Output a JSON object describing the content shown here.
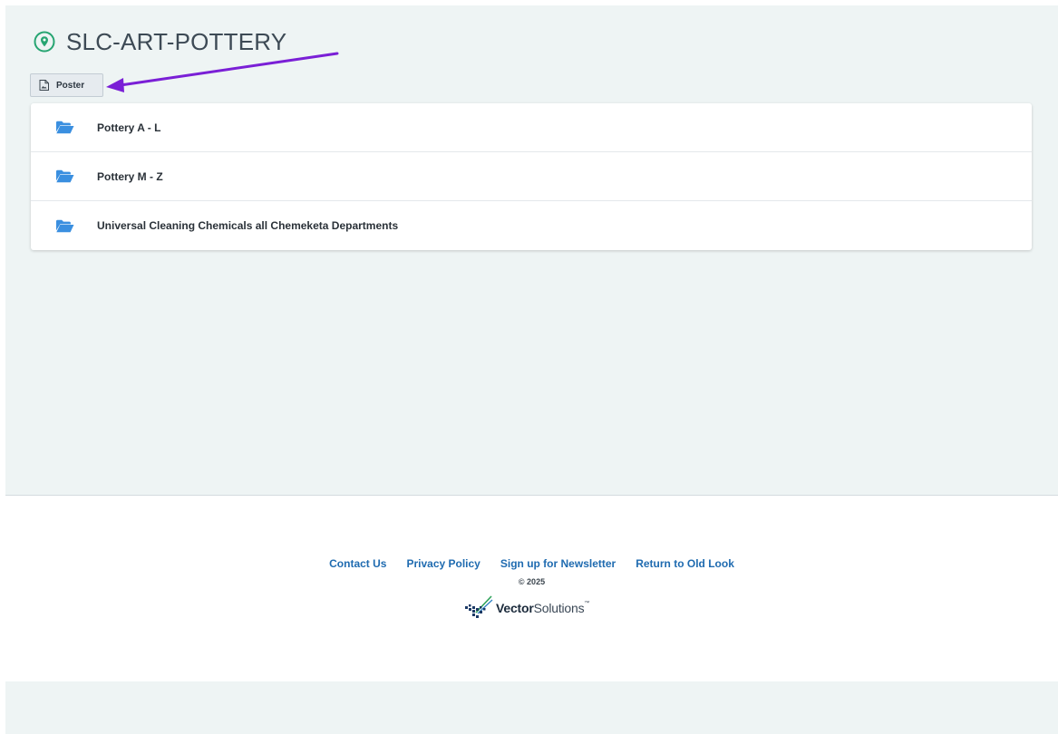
{
  "page": {
    "title": "SLC-ART-POTTERY",
    "location_icon": "map-pin-icon",
    "accent_color": "#27a572"
  },
  "toolbar": {
    "poster_label": "Poster",
    "poster_icon": "image-file-icon"
  },
  "annotation": {
    "arrow_color": "#7a1fd6",
    "points_to": "poster-button"
  },
  "folders": {
    "icon": "folder-open-icon",
    "icon_color": "#3a8fe0",
    "items": [
      {
        "label": "Pottery A - L"
      },
      {
        "label": "Pottery M - Z"
      },
      {
        "label": "Universal Cleaning Chemicals all Chemeketa Departments"
      }
    ]
  },
  "footer": {
    "links": [
      {
        "label": "Contact Us"
      },
      {
        "label": "Privacy Policy"
      },
      {
        "label": "Sign up for Newsletter"
      },
      {
        "label": "Return to Old Look"
      }
    ],
    "link_color": "#1f6bb0",
    "copyright": "© 2025",
    "logo": {
      "bold_text": "Vector",
      "light_text": "Solutions",
      "trademark": "™",
      "icon": "vector-solutions-logo-icon"
    }
  }
}
